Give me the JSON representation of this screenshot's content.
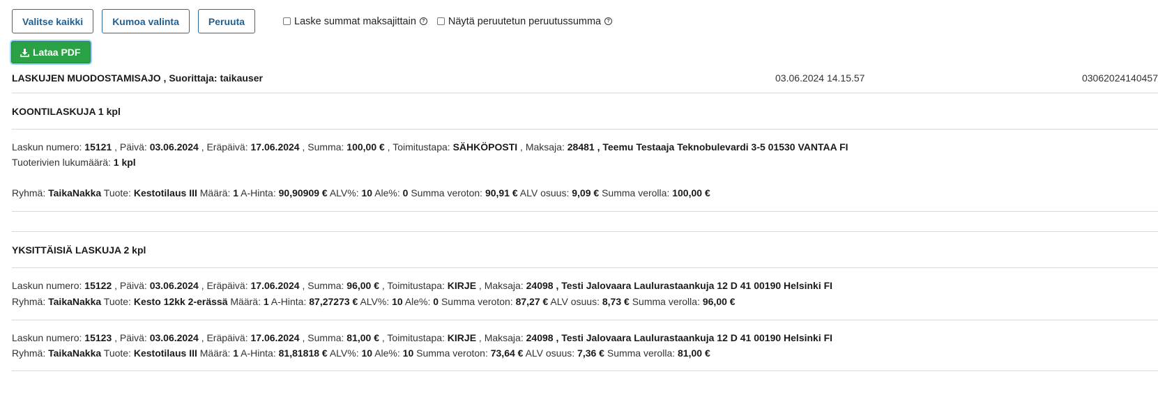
{
  "toolbar": {
    "select_all": "Valitse kaikki",
    "undo_selection": "Kumoa valinta",
    "cancel": "Peruuta",
    "checkbox_sum_by_payer": "Laske summat maksajittain",
    "checkbox_show_cancelled": "Näytä peruutetun peruutussumma",
    "help_glyph": "?"
  },
  "pdf_button": {
    "label": "Lataa PDF"
  },
  "header": {
    "title": "LASKUJEN MUODOSTAMISAJO",
    "performer_label": ", Suorittaja:",
    "performer": "taikauser",
    "datetime": "03.06.2024 14.15.57",
    "run_id": "03062024140457"
  },
  "labels": {
    "invoice_number": "Laskun numero:",
    "date": ", Päivä:",
    "due_date": ", Eräpäivä:",
    "sum": ", Summa:",
    "delivery": ", Toimitustapa:",
    "payer": ", Maksaja:",
    "rows_count": "Tuoterivien lukumäärä:",
    "group": "Ryhmä:",
    "product": "Tuote:",
    "quantity": "Määrä:",
    "unit_price": "A-Hinta:",
    "vat_pct": "ALV%:",
    "discount_pct": "Ale%:",
    "sum_excl_vat": "Summa veroton:",
    "vat_share": "ALV osuus:",
    "sum_incl_vat": "Summa verolla:"
  },
  "summary_section": {
    "title": "KOONTILASKUJA 1 kpl",
    "invoice": {
      "number": "15121",
      "date": "03.06.2024",
      "due": "17.06.2024",
      "sum": "100,00 €",
      "delivery": "SÄHKÖPOSTI",
      "payer_id": "28481",
      "payer": ", Teemu Testaaja Teknobulevardi 3-5 01530 VANTAA FI",
      "rows_count": "1 kpl",
      "row": {
        "group": "TaikaNakka",
        "product": "Kestotilaus III",
        "qty": "1",
        "unit_price": "90,90909 €",
        "vat": "10",
        "discount": "0",
        "net": "90,91 €",
        "vat_share": "9,09 €",
        "gross": "100,00 €"
      }
    }
  },
  "individual_section": {
    "title": "YKSITTÄISIÄ LASKUJA 2 kpl",
    "invoices": [
      {
        "number": "15122",
        "date": "03.06.2024",
        "due": "17.06.2024",
        "sum": "96,00 €",
        "delivery": "KIRJE",
        "payer_id": "24098",
        "payer": ", Testi Jalovaara Laulurastaankuja 12 D 41 00190 Helsinki FI",
        "row": {
          "group": "TaikaNakka",
          "product": "Kesto 12kk 2-erässä",
          "qty": "1",
          "unit_price": "87,27273 €",
          "vat": "10",
          "discount": "0",
          "net": "87,27 €",
          "vat_share": "8,73 €",
          "gross": "96,00 €"
        }
      },
      {
        "number": "15123",
        "date": "03.06.2024",
        "due": "17.06.2024",
        "sum": "81,00 €",
        "delivery": "KIRJE",
        "payer_id": "24098",
        "payer": ", Testi Jalovaara Laulurastaankuja 12 D 41 00190 Helsinki FI",
        "row": {
          "group": "TaikaNakka",
          "product": "Kestotilaus III",
          "qty": "1",
          "unit_price": "81,81818 €",
          "vat": "10",
          "discount": "10",
          "net": "73,64 €",
          "vat_share": "7,36 €",
          "gross": "81,00 €"
        }
      }
    ]
  },
  "colors": {
    "primary_btn_text": "#1f5f92",
    "pdf_green": "#2aa144",
    "divider": "#d8d8d8"
  }
}
